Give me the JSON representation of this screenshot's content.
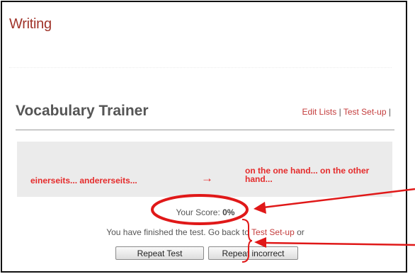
{
  "page": {
    "section_title": "Writing"
  },
  "trainer": {
    "title": "Vocabulary Trainer",
    "links": {
      "edit_lists": "Edit Lists",
      "separator": "|",
      "test_setup": "Test Set-up",
      "trailing_separator": "|"
    }
  },
  "card": {
    "german": "einerseits... andererseits...",
    "arrow": "→",
    "english": "on the one hand... on the other hand..."
  },
  "score": {
    "label": "Your Score:",
    "value": "0%"
  },
  "result": {
    "message_prefix": "You have finished the test. Go back to",
    "link": "Test Set-up",
    "message_suffix": "or"
  },
  "buttons": {
    "repeat_test": "Repeat Test",
    "repeat_incorrect": "Repeat incorrect"
  },
  "annotations": {
    "color": "#e01818"
  }
}
